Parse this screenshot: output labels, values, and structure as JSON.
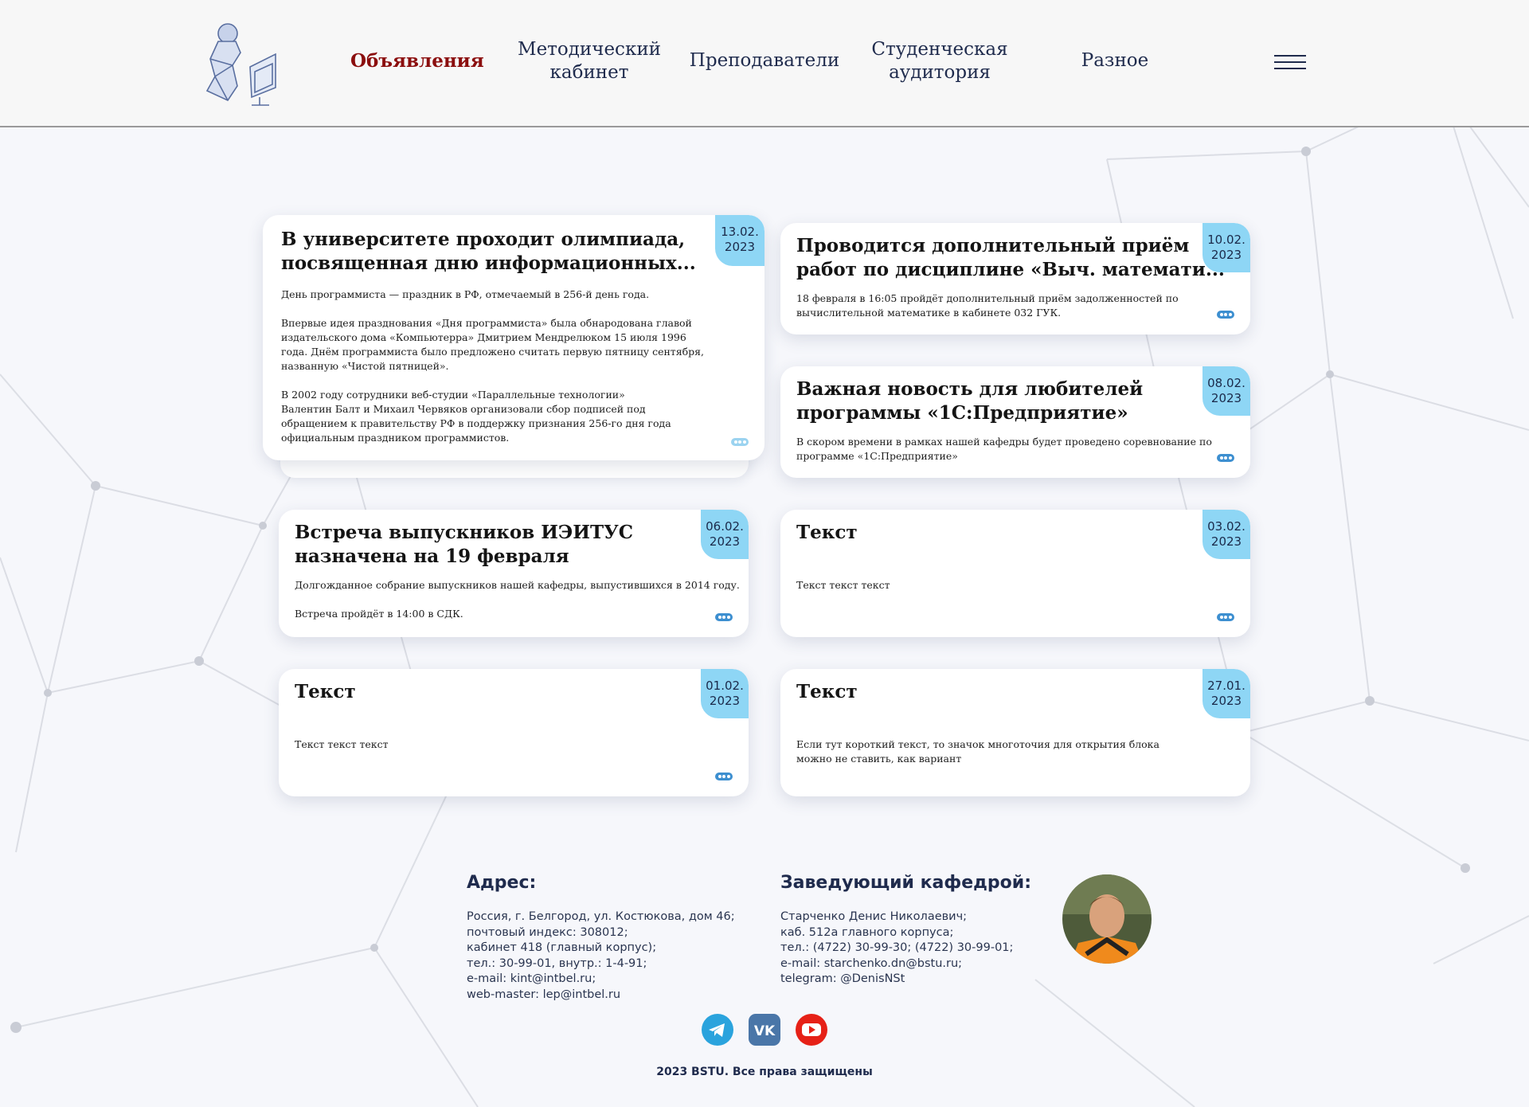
{
  "nav": {
    "items": [
      {
        "label": "Объявления",
        "active": true
      },
      {
        "label": "Методический\nкабинет"
      },
      {
        "label": "Преподаватели"
      },
      {
        "label": "Студенческая\nаудитория"
      },
      {
        "label": "Разное"
      }
    ],
    "menu_icon": "hamburger-icon",
    "colors": {
      "active": "#8b0e0e",
      "normal": "#1f2b4d"
    }
  },
  "cards": [
    {
      "title": "В университете проходит олимпиада,\nпосвященная дню информационных...",
      "date": "13.02.\n2023",
      "text": "День программиста — праздник в РФ, отмечаемый в 256-й день года.\n\nВпервые идея празднования «Дня программиста» была обнародована главой\nиздательского дома «Компьютерра» Дмитрием Мендрелюком 15 июля 1996\nгода. Днём программиста было предложено считать первую пятницу сентября,\nназванную «Чистой пятницей».\n\nВ 2002 году сотрудники веб-студии «Параллельные технологии»\nВалентин Балт и Михаил Червяков организовали сбор подписей под\nобращением к правительству РФ в поддержку признания 256-го дня года\nофициальным праздником программистов."
    },
    {
      "title": "Проводится дополнительный приём\nработ по дисциплине «Выч. математи...",
      "date": "10.02.\n2023",
      "text": "18 февраля в 16:05 пройдёт дополнительный приём задолженностей по\nвычислительной математике в кабинете 032 ГУК."
    },
    {
      "title": "Важная новость для любителей\nпрограммы «1С:Предприятие»",
      "date": "08.02.\n2023",
      "text": "В скором времени в рамках нашей кафедры будет проведено соревнование по\nпрограмме «1С:Предприятие»"
    },
    {
      "title": "Встреча выпускников ИЭИТУС\nназначена на 19 февраля",
      "date": "06.02.\n2023",
      "text": "Долгожданное собрание выпускников нашей кафедры, выпустившихся в 2014 году.\n\nВстреча пройдёт в 14:00 в СДК."
    },
    {
      "title": "Текст",
      "date": "03.02.\n2023",
      "text": "Текст текст текст"
    },
    {
      "title": "Текст",
      "date": "01.02.\n2023",
      "text": "Текст текст текст"
    },
    {
      "title": "Текст",
      "date": "27.01.\n2023",
      "text": "Если тут короткий текст, то значок многоточия для открытия блока\nможно не ставить, как вариант"
    }
  ],
  "footer": {
    "address_title": "Адрес:",
    "address_text": "Россия, г. Белгород, ул. Костюкова, дом 46;\nпочтовый индекс: 308012;\nкабинет 418 (главный корпус);\nтел.: 30-99-01, внутр.: 1-4-91;\ne-mail: kint@intbel.ru;\nweb-master: lep@intbel.ru",
    "head_title": "Заведующий кафедрой:",
    "head_text": "Старченко Денис Николаевич;\nкаб. 512а главного корпуса;\nтел.: (4722) 30-99-30; (4722) 30-99-01;\ne-mail: starchenko.dn@bstu.ru;\ntelegram: @DenisNSt",
    "social": [
      "telegram-icon",
      "vk-icon",
      "youtube-icon"
    ],
    "copyright": "2023 BSTU. Все права защищены"
  },
  "colors": {
    "date_badge": "#8ed6f5",
    "dots": "#3d8fd0",
    "telegram": "#2aa3dd",
    "vk": "#4a76a8",
    "youtube": "#e62117"
  }
}
